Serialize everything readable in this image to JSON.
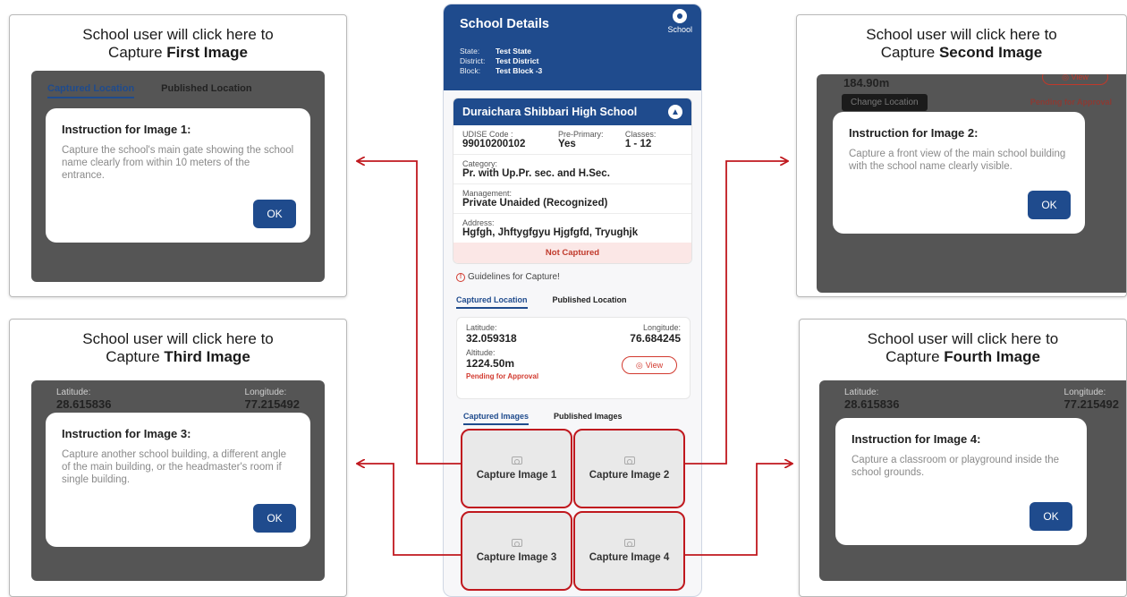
{
  "colors": {
    "accent": "#1f4b8d",
    "arrow_red": "#c0181e",
    "status_red": "#d23a2f"
  },
  "callouts": [
    {
      "heading_line1": "School user will click here to",
      "heading_prefix": "Capture ",
      "heading_bold": "First Image",
      "panel_tabs": [
        "Captured Location",
        "Published Location"
      ],
      "dialog_title": "Instruction for Image 1:",
      "dialog_text": "Capture the school's main gate showing the school name clearly from within 10 meters of the entrance.",
      "ok": "OK"
    },
    {
      "heading_line1": "School user will click here to",
      "heading_prefix": "Capture ",
      "heading_bold": "Second Image",
      "panel_altitude": "184.90m",
      "panel_button": "Change Location",
      "panel_status": "Pending for Approval",
      "panel_view": "View",
      "dialog_title": "Instruction for Image 2:",
      "dialog_text": "Capture a front view of the main school building with the school name clearly visible.",
      "ok": "OK"
    },
    {
      "heading_line1": "School user will click here to",
      "heading_prefix": "Capture ",
      "heading_bold": "Third Image",
      "lat_label": "Latitude:",
      "lat": "28.615836",
      "lon_label": "Longitude:",
      "lon": "77.215492",
      "dialog_title": "Instruction for Image 3:",
      "dialog_text": "Capture another school building, a different angle of the main building, or the headmaster's room if single building.",
      "ok": "OK"
    },
    {
      "heading_line1": "School user will click here to",
      "heading_prefix": "Capture ",
      "heading_bold": "Fourth Image",
      "lat_label": "Latitude:",
      "lat": "28.615836",
      "lon_label": "Longitude:",
      "lon": "77.215492",
      "dialog_title": "Instruction for Image 4:",
      "dialog_text": "Capture a classroom or playground inside the school grounds.",
      "ok": "OK"
    }
  ],
  "phone": {
    "title": "School Details",
    "school_tag": "School",
    "meta": [
      {
        "k": "State:",
        "v": "Test State"
      },
      {
        "k": "District:",
        "v": "Test District"
      },
      {
        "k": "Block:",
        "v": "Test Block -3"
      }
    ],
    "school_name": "Duraichara Shibbari High School",
    "udise_label": "UDISE Code :",
    "udise": "99010200102",
    "preprimary_label": "Pre-Primary:",
    "preprimary": "Yes",
    "classes_label": "Classes:",
    "classes": "1 - 12",
    "category_label": "Category:",
    "category": "Pr. with Up.Pr. sec. and H.Sec.",
    "management_label": "Management:",
    "management": "Private Unaided (Recognized)",
    "address_label": "Address:",
    "address": "Hgfgh, Jhftygfgyu Hjgfgfd, Tryughjk",
    "status": "Not Captured",
    "guidelines": "Guidelines for Capture!",
    "location_tabs": [
      "Captured Location",
      "Published Location"
    ],
    "latitude_label": "Latitude:",
    "latitude": "32.059318",
    "longitude_label": "Longitude:",
    "longitude": "76.684245",
    "altitude_label": "Altitude:",
    "altitude": "1224.50m",
    "view": "View",
    "pending": "Pending for Approval",
    "image_tabs": [
      "Captured Images",
      "Published Images"
    ],
    "captures": [
      "Capture Image 1",
      "Capture Image 2",
      "Capture Image 3",
      "Capture Image 4"
    ]
  }
}
